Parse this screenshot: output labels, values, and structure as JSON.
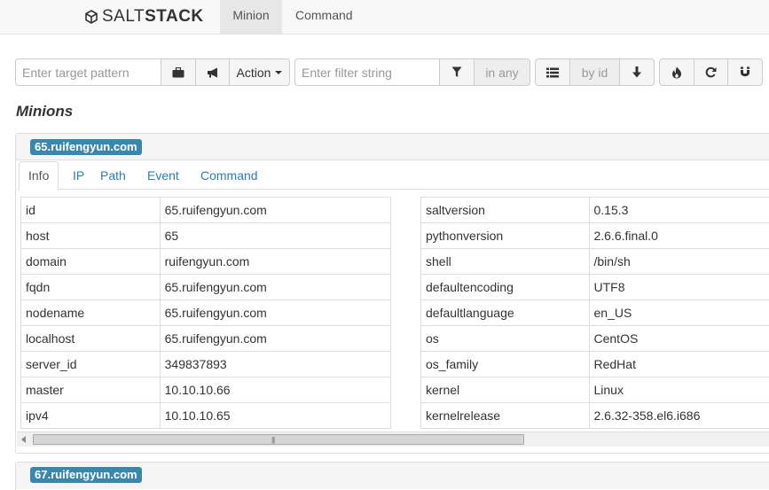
{
  "navbar": {
    "brand_light": "SALT",
    "brand_bold": "STACK",
    "tabs": [
      {
        "label": "Minion",
        "active": true
      },
      {
        "label": "Command",
        "active": false
      }
    ]
  },
  "toolbar": {
    "target_placeholder": "Enter target pattern",
    "action_label": "Action",
    "filter_placeholder": "Enter filter string",
    "in_any_label": "in any",
    "by_id_label": "by id",
    "icons": [
      "briefcase-icon",
      "bullhorn-icon",
      "filter-icon",
      "list-icon",
      "arrow-down-icon",
      "fire-icon",
      "refresh-icon",
      "magnet-icon"
    ]
  },
  "page_title": "Minions",
  "minions": [
    {
      "id": "65.ruifengyun.com",
      "tabs": [
        "Info",
        "IP",
        "Path",
        "Event",
        "Command"
      ],
      "active_tab": "Info",
      "grains_left": [
        [
          "id",
          "65.ruifengyun.com"
        ],
        [
          "host",
          "65"
        ],
        [
          "domain",
          "ruifengyun.com"
        ],
        [
          "fqdn",
          "65.ruifengyun.com"
        ],
        [
          "nodename",
          "65.ruifengyun.com"
        ],
        [
          "localhost",
          "65.ruifengyun.com"
        ],
        [
          "server_id",
          "349837893"
        ],
        [
          "master",
          "10.10.10.66"
        ],
        [
          "ipv4",
          "10.10.10.65"
        ]
      ],
      "grains_right": [
        [
          "saltversion",
          "0.15.3"
        ],
        [
          "pythonversion",
          "2.6.6.final.0"
        ],
        [
          "shell",
          "/bin/sh"
        ],
        [
          "defaultencoding",
          "UTF8"
        ],
        [
          "defaultlanguage",
          "en_US"
        ],
        [
          "os",
          "CentOS"
        ],
        [
          "os_family",
          "RedHat"
        ],
        [
          "kernel",
          "Linux"
        ],
        [
          "kernelrelease",
          "2.6.32-358.el6.i686"
        ]
      ]
    },
    {
      "id": "67.ruifengyun.com"
    }
  ],
  "colors": {
    "badge": "#3a87ad",
    "link": "#2a7fb2"
  }
}
